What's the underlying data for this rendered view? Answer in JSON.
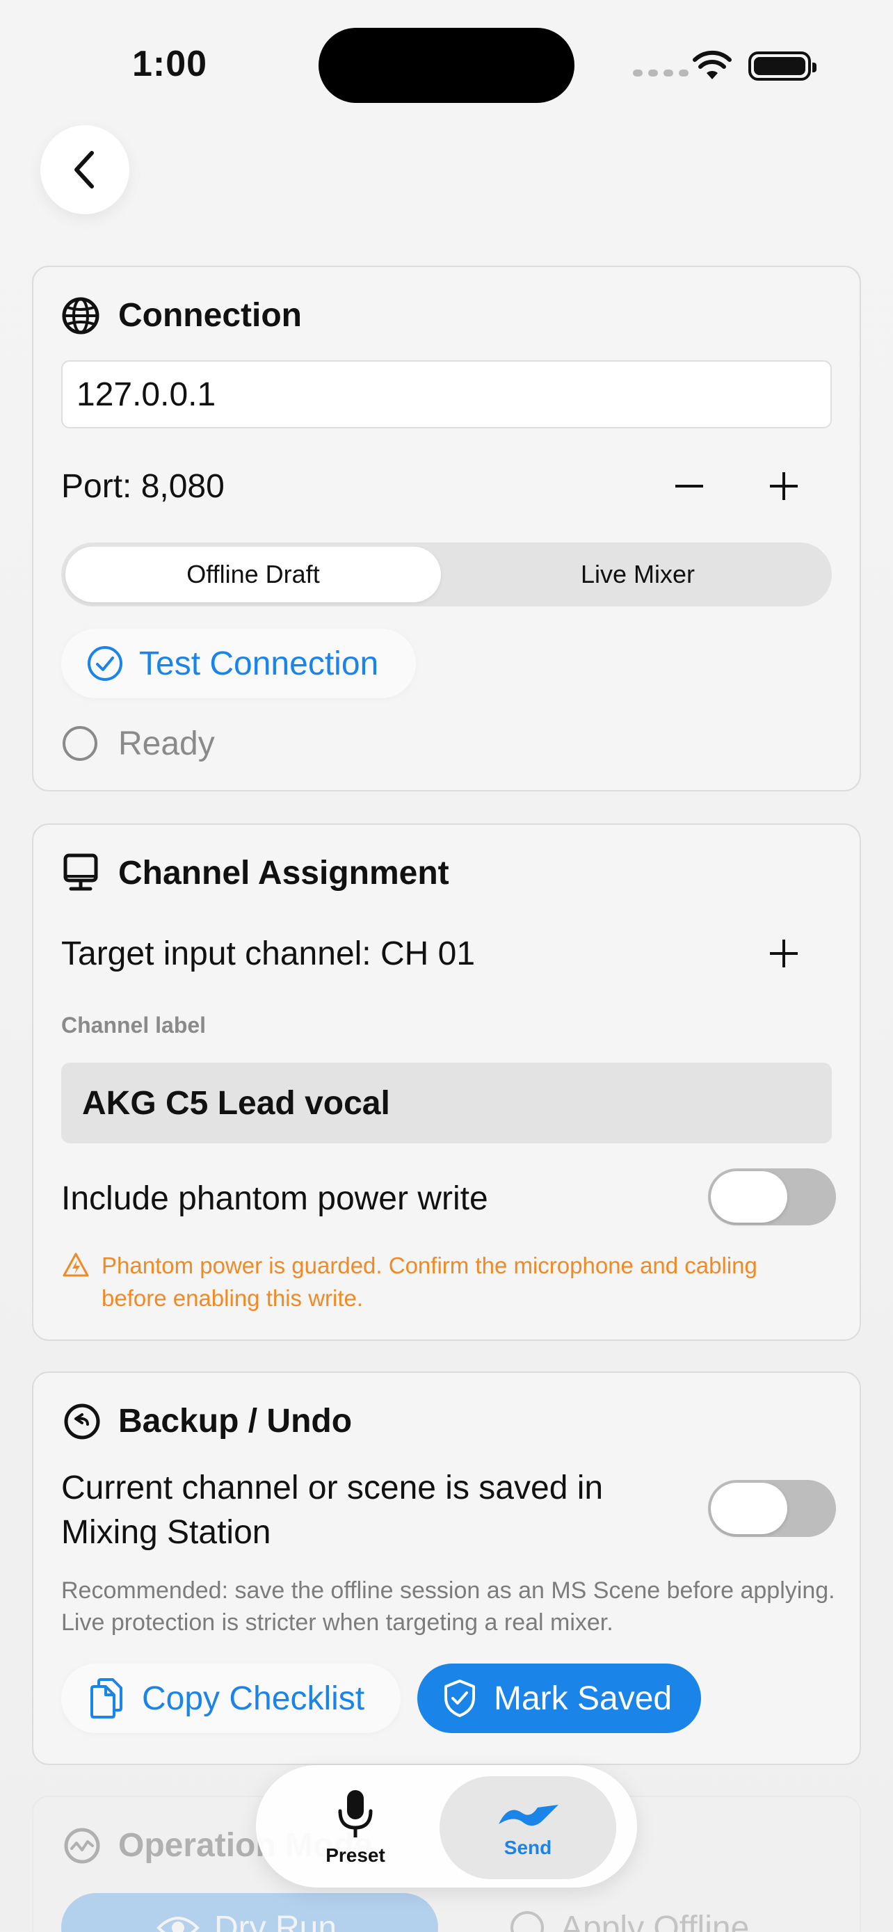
{
  "status_bar": {
    "time": "1:00"
  },
  "connection": {
    "title": "Connection",
    "ip_value": "127.0.0.1",
    "port_label": "Port: 8,080",
    "modes": [
      "Offline Draft",
      "Live Mixer"
    ],
    "selected_mode": "Offline Draft",
    "test_button": "Test Connection",
    "status": "Ready"
  },
  "channel": {
    "title": "Channel Assignment",
    "target_label": "Target input channel: CH 01",
    "label_caption": "Channel label",
    "label_value": "AKG C5 Lead vocal",
    "phantom_label": "Include phantom power write",
    "phantom_on": false,
    "warning": "Phantom power is guarded. Confirm the microphone and cabling before enabling this write."
  },
  "backup": {
    "title": "Backup / Undo",
    "saved_label": "Current channel or scene is saved in Mixing Station",
    "saved_on": false,
    "recommendation": "Recommended: save the offline session as an MS Scene before applying. Live protection is stricter when targeting a real mixer.",
    "copy_button": "Copy Checklist",
    "mark_button": "Mark Saved"
  },
  "operation": {
    "title": "Operation Mode",
    "dry_run_button": "Dry Run",
    "apply_button": "Apply Offline"
  },
  "tabbar": {
    "tabs": [
      {
        "label": "Preset",
        "icon": "mic-icon"
      },
      {
        "label": "Send",
        "icon": "send-icon"
      }
    ],
    "active": "Send"
  },
  "colors": {
    "accent": "#1a84e8",
    "warning": "#f08a24"
  }
}
